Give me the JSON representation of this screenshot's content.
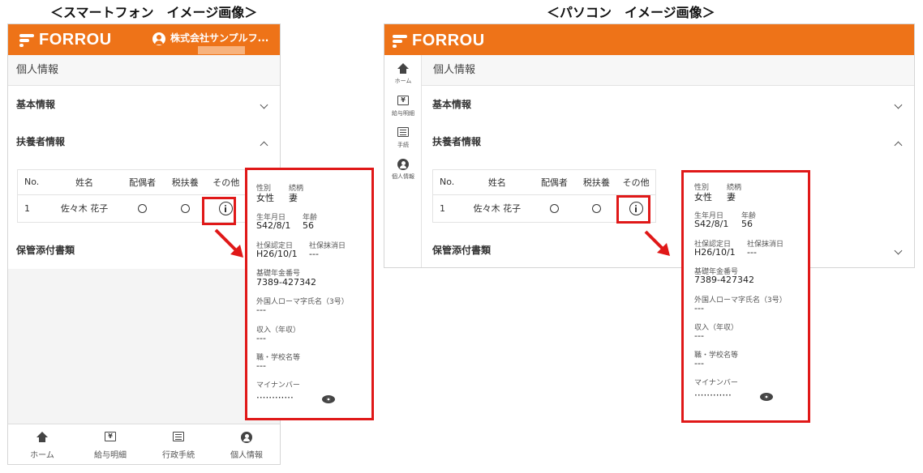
{
  "captions": {
    "phone": "＜スマートフォン　イメージ画像＞",
    "pc": "＜パソコン　イメージ画像＞"
  },
  "header": {
    "logo_text": "FORROU",
    "company_name": "株式会社サンプルフ..."
  },
  "page": {
    "title": "個人情報",
    "sections": {
      "basic": "基本情報",
      "dependents": "扶養者情報",
      "attachments": "保管添付書類"
    }
  },
  "dependents_table": {
    "headers": [
      "No.",
      "姓名",
      "配偶者",
      "税扶養",
      "その他"
    ],
    "rows": [
      {
        "no": "1",
        "name": "佐々木 花子"
      }
    ]
  },
  "bottom_nav": [
    {
      "label": "ホーム",
      "icon": "home-icon"
    },
    {
      "label": "給与明細",
      "icon": "yen-icon"
    },
    {
      "label": "行政手続",
      "icon": "list-icon"
    },
    {
      "label": "個人情報",
      "icon": "person-icon"
    }
  ],
  "side_nav": [
    {
      "label": "ホーム",
      "icon": "home-icon"
    },
    {
      "label": "給与明細",
      "icon": "yen-icon"
    },
    {
      "label": "手続",
      "icon": "list-icon"
    },
    {
      "label": "個人情報",
      "icon": "person-icon"
    }
  ],
  "detail": {
    "gender_label": "性別",
    "relation_label": "続柄",
    "gender_value": "女性",
    "relation_value": "妻",
    "birth_label": "生年月日",
    "age_label": "年齢",
    "birth_value": "S42/8/1",
    "age_value": "56",
    "ins_start_label": "社保認定日",
    "ins_end_label": "社保抹消日",
    "ins_start_value": "H26/10/1",
    "ins_end_value": "---",
    "pension_label": "基礎年金番号",
    "pension_value": "7389-427342",
    "foreign_name_label": "外国人ローマ字氏名（3号）",
    "foreign_name_value": "---",
    "income_label": "収入（年収）",
    "income_value": "---",
    "school_label": "職・学校名等",
    "school_value": "---",
    "mynumber_label": "マイナンバー",
    "mynumber_value": "············"
  },
  "colors": {
    "brand": "#ee7318",
    "highlight": "#e01818"
  }
}
